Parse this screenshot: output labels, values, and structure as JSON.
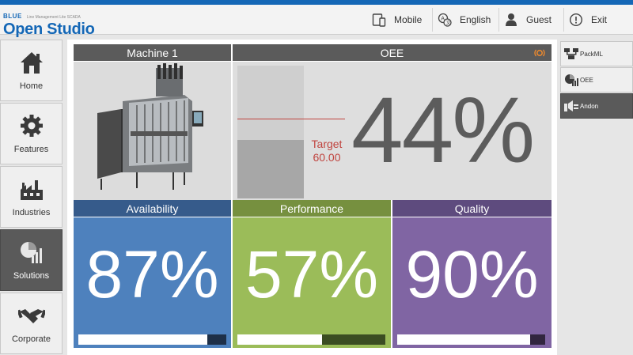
{
  "header": {
    "brand": "BLUE",
    "tagline": "Line Management Lite SCADA",
    "app_name": "Open Studio",
    "buttons": [
      {
        "label": "Mobile",
        "icon": "mobile-icon"
      },
      {
        "label": "English",
        "icon": "language-icon"
      },
      {
        "label": "Guest",
        "icon": "user-icon"
      },
      {
        "label": "Exit",
        "icon": "exit-icon"
      }
    ]
  },
  "sidebar": {
    "items": [
      {
        "label": "Home",
        "icon": "home-icon",
        "active": false
      },
      {
        "label": "Features",
        "icon": "gear-icon",
        "active": false
      },
      {
        "label": "Industries",
        "icon": "factory-icon",
        "active": false
      },
      {
        "label": "Solutions",
        "icon": "solutions-chart-icon",
        "active": true
      },
      {
        "label": "Corporate",
        "icon": "handshake-icon",
        "active": false
      }
    ]
  },
  "machine": {
    "title": "Machine 1"
  },
  "oee": {
    "title": "OEE",
    "value": "44%",
    "fill_fraction": 0.44,
    "target_label": "Target",
    "target_value": "60.00",
    "target_fraction": 0.6
  },
  "kpis": [
    {
      "title": "Availability",
      "value": "87%",
      "fraction": 0.87,
      "head_color": "#365b8b",
      "body_color": "#4e81bd",
      "bar_color": "#1e3048"
    },
    {
      "title": "Performance",
      "value": "57%",
      "fraction": 0.57,
      "head_color": "#76903f",
      "body_color": "#9bbc59",
      "bar_color": "#3b4d22"
    },
    {
      "title": "Quality",
      "value": "90%",
      "fraction": 0.9,
      "head_color": "#5e4b7e",
      "body_color": "#8065a3",
      "bar_color": "#32263f"
    }
  ],
  "rightnav": {
    "items": [
      {
        "label": "PackML",
        "icon": "packml-icon",
        "active": false
      },
      {
        "label": "OEE",
        "icon": "oee-icon",
        "active": false
      },
      {
        "label": "Andon",
        "icon": "andon-icon",
        "active": true
      }
    ]
  },
  "colors": {
    "accent": "#1467b6",
    "target": "#c0443f"
  }
}
